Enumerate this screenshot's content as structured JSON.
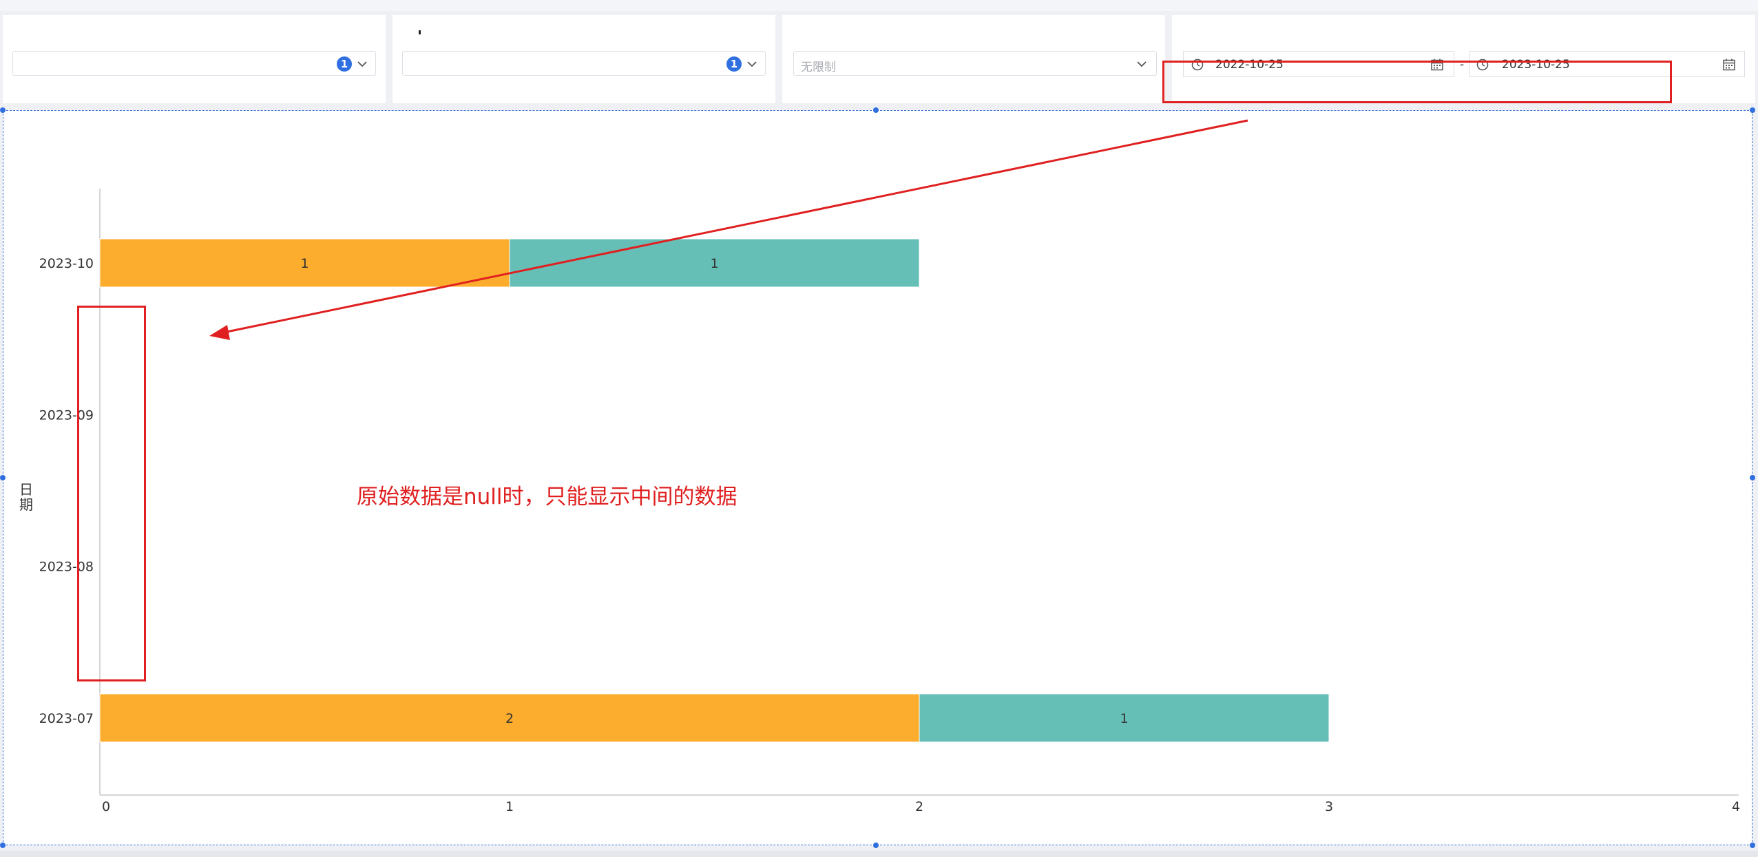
{
  "filters": {
    "filter1": {
      "badge": "1"
    },
    "filter2": {
      "badge": "1"
    },
    "filter3": {
      "placeholder": "无限制"
    },
    "date_range": {
      "start": "2022-10-25",
      "separator": "-",
      "end": "2023-10-25"
    }
  },
  "annotation": {
    "text": "原始数据是null时，只能显示中间的数据"
  },
  "colors": {
    "series1": "#FDAD2D",
    "series2": "#66BFB7",
    "annotation": "#E02020",
    "selection": "#2F6FE0"
  },
  "chart_data": {
    "type": "bar",
    "orientation": "horizontal",
    "stacked": true,
    "categories": [
      "2023-07",
      "2023-08",
      "2023-09",
      "2023-10"
    ],
    "series": [
      {
        "values": [
          0,
          null,
          null,
          0
        ]
      },
      {
        "values": [
          2,
          null,
          null,
          1
        ]
      },
      {
        "values": [
          1,
          null,
          null,
          1
        ]
      }
    ],
    "xlim": [
      0,
      4
    ],
    "x_ticks": [
      "0",
      "1",
      "2",
      "3",
      "4"
    ],
    "ylabel": "日期"
  }
}
